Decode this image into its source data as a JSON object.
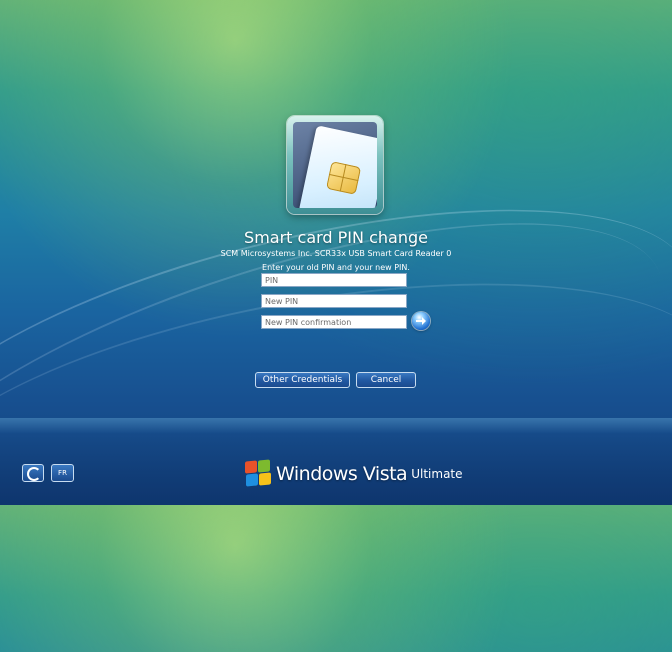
{
  "dialog": {
    "title": "Smart card PIN change",
    "reader_name": "SCM Microsystems Inc. SCR33x USB Smart Card Reader 0",
    "instruction": "Enter your old PIN and your new PIN.",
    "tile_icon": "smart-card-icon"
  },
  "fields": {
    "pin_placeholder": "PIN",
    "new_pin_placeholder": "New PIN",
    "confirm_pin_placeholder": "New PIN confirmation"
  },
  "go_button": {
    "icon": "arrow-right-icon"
  },
  "buttons": {
    "other_credentials": "Other Credentials",
    "cancel": "Cancel"
  },
  "bottom_bar": {
    "ease_of_access_icon": "ease-of-access-icon",
    "language": "FR"
  },
  "branding": {
    "product": "Windows Vista",
    "edition": "Ultimate",
    "logo_colors": [
      "#e8522a",
      "#7dba2e",
      "#1e8fe0",
      "#f6c21a"
    ]
  }
}
